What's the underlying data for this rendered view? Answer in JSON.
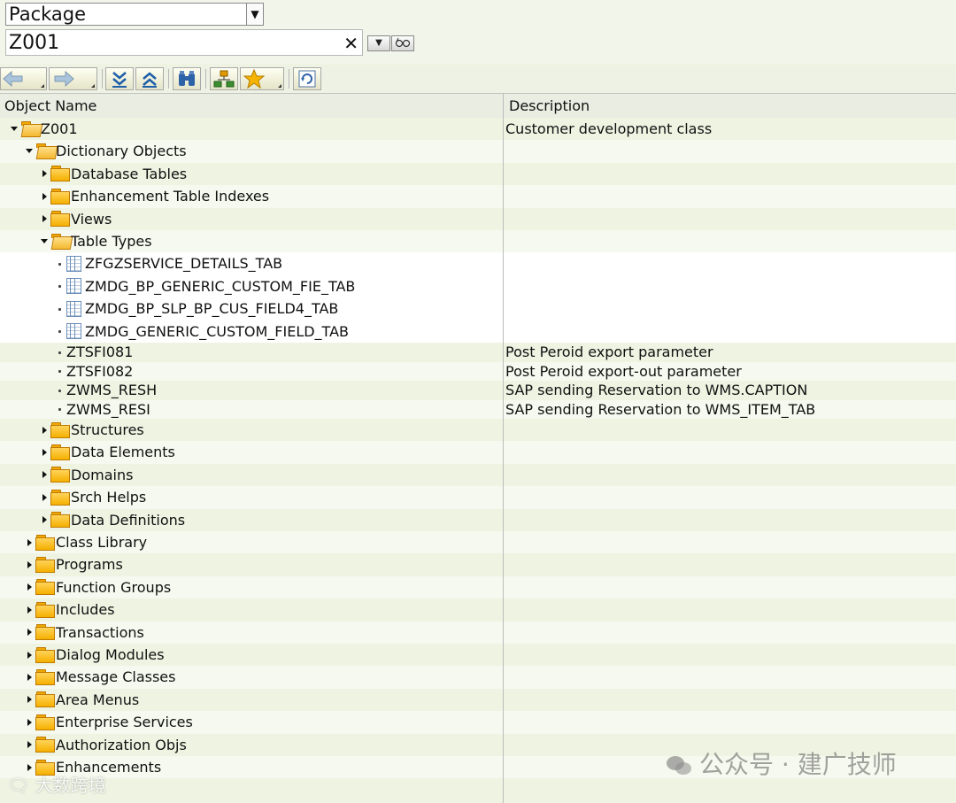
{
  "selector": {
    "type_value": "Package",
    "name_value": "Z001"
  },
  "table": {
    "col_object_name": "Object Name",
    "col_description": "Description"
  },
  "tree": [
    {
      "label": "Z001",
      "desc": "Customer development class",
      "level": 0,
      "kind": "folder-open",
      "exp": "open"
    },
    {
      "label": "Dictionary Objects",
      "desc": "",
      "level": 1,
      "kind": "folder-open",
      "exp": "open"
    },
    {
      "label": "Database Tables",
      "desc": "",
      "level": 2,
      "kind": "folder",
      "exp": "closed"
    },
    {
      "label": "Enhancement Table Indexes",
      "desc": "",
      "level": 2,
      "kind": "folder",
      "exp": "closed"
    },
    {
      "label": "Views",
      "desc": "",
      "level": 2,
      "kind": "folder",
      "exp": "closed"
    },
    {
      "label": "Table Types",
      "desc": "",
      "level": 2,
      "kind": "folder-open",
      "exp": "open"
    },
    {
      "label": "ZFGZSERVICE_DETAILS_TAB",
      "desc": "",
      "level": 3,
      "kind": "tabletype",
      "exp": "leaf"
    },
    {
      "label": "ZMDG_BP_GENERIC_CUSTOM_FIE_TAB",
      "desc": "",
      "level": 3,
      "kind": "tabletype",
      "exp": "leaf"
    },
    {
      "label": "ZMDG_BP_SLP_BP_CUS_FIELD4_TAB",
      "desc": "",
      "level": 3,
      "kind": "tabletype",
      "exp": "leaf"
    },
    {
      "label": "ZMDG_GENERIC_CUSTOM_FIELD_TAB",
      "desc": "",
      "level": 3,
      "kind": "tabletype",
      "exp": "leaf"
    },
    {
      "label": "ZTSFI081",
      "desc": "Post Peroid export parameter",
      "level": 3,
      "kind": "plain",
      "exp": "leaf"
    },
    {
      "label": "ZTSFI082",
      "desc": "Post Peroid export-out parameter",
      "level": 3,
      "kind": "plain",
      "exp": "leaf"
    },
    {
      "label": "ZWMS_RESH",
      "desc": "SAP sending Reservation to WMS.CAPTION",
      "level": 3,
      "kind": "plain",
      "exp": "leaf"
    },
    {
      "label": "ZWMS_RESI",
      "desc": "SAP sending Reservation to WMS_ITEM_TAB",
      "level": 3,
      "kind": "plain",
      "exp": "leaf"
    },
    {
      "label": "Structures",
      "desc": "",
      "level": 2,
      "kind": "folder",
      "exp": "closed"
    },
    {
      "label": "Data Elements",
      "desc": "",
      "level": 2,
      "kind": "folder",
      "exp": "closed"
    },
    {
      "label": "Domains",
      "desc": "",
      "level": 2,
      "kind": "folder",
      "exp": "closed"
    },
    {
      "label": "Srch Helps",
      "desc": "",
      "level": 2,
      "kind": "folder",
      "exp": "closed"
    },
    {
      "label": "Data Definitions",
      "desc": "",
      "level": 2,
      "kind": "folder",
      "exp": "closed"
    },
    {
      "label": "Class Library",
      "desc": "",
      "level": 1,
      "kind": "folder",
      "exp": "closed"
    },
    {
      "label": "Programs",
      "desc": "",
      "level": 1,
      "kind": "folder",
      "exp": "closed"
    },
    {
      "label": "Function Groups",
      "desc": "",
      "level": 1,
      "kind": "folder",
      "exp": "closed"
    },
    {
      "label": "Includes",
      "desc": "",
      "level": 1,
      "kind": "folder",
      "exp": "closed"
    },
    {
      "label": "Transactions",
      "desc": "",
      "level": 1,
      "kind": "folder",
      "exp": "closed"
    },
    {
      "label": "Dialog Modules",
      "desc": "",
      "level": 1,
      "kind": "folder",
      "exp": "closed"
    },
    {
      "label": "Message Classes",
      "desc": "",
      "level": 1,
      "kind": "folder",
      "exp": "closed"
    },
    {
      "label": "Area Menus",
      "desc": "",
      "level": 1,
      "kind": "folder",
      "exp": "closed"
    },
    {
      "label": "Enterprise Services",
      "desc": "",
      "level": 1,
      "kind": "folder",
      "exp": "closed"
    },
    {
      "label": "Authorization Objs",
      "desc": "",
      "level": 1,
      "kind": "folder",
      "exp": "closed"
    },
    {
      "label": "Enhancements",
      "desc": "",
      "level": 1,
      "kind": "folder",
      "exp": "closed"
    }
  ],
  "watermark": {
    "right_text": "公众号 · 建广技师",
    "left_text": "大数跨境"
  },
  "icons": {
    "back": "arrow-left-icon",
    "forward": "arrow-right-icon",
    "expand_all": "expand-subtree-icon",
    "collapse_all": "collapse-subtree-icon",
    "find": "binoculars-icon",
    "hierarchy": "hierarchy-icon",
    "favorites": "star-icon",
    "refresh": "refresh-icon"
  }
}
